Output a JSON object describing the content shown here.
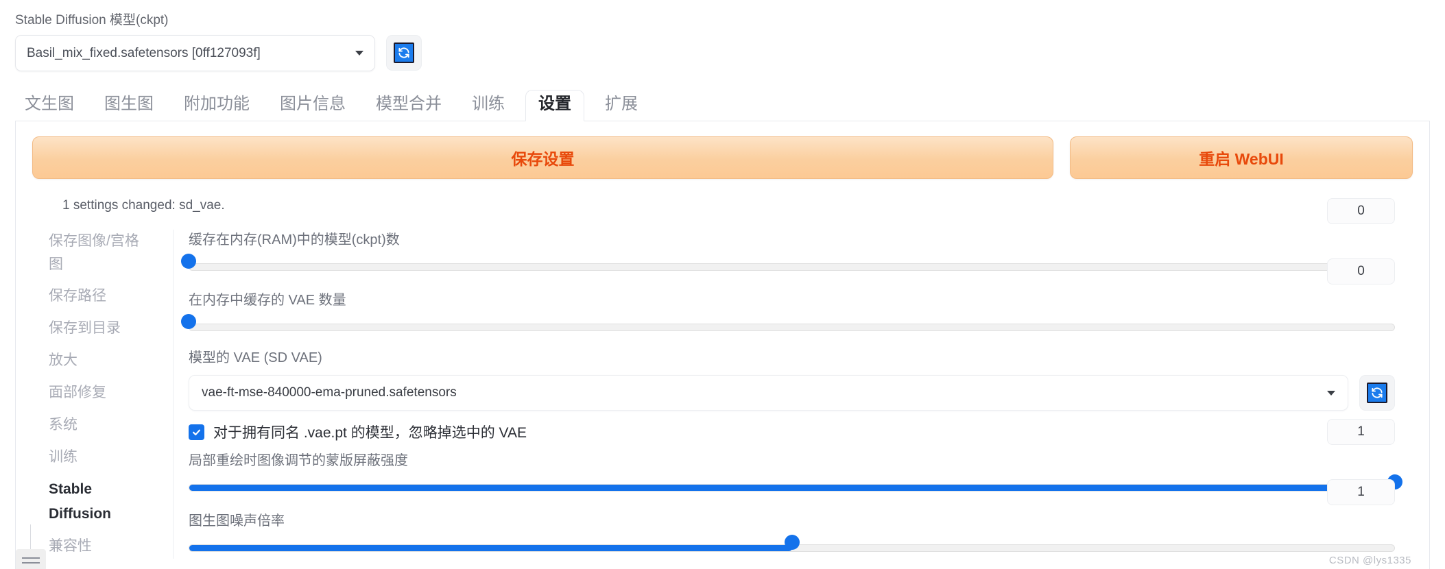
{
  "model_selector": {
    "label": "Stable Diffusion 模型(ckpt)",
    "value": "Basil_mix_fixed.safetensors [0ff127093f]",
    "refresh_icon": "refresh-icon"
  },
  "tabs": [
    {
      "label": "文生图",
      "active": false
    },
    {
      "label": "图生图",
      "active": false
    },
    {
      "label": "附加功能",
      "active": false
    },
    {
      "label": "图片信息",
      "active": false
    },
    {
      "label": "模型合并",
      "active": false
    },
    {
      "label": "训练",
      "active": false
    },
    {
      "label": "设置",
      "active": true
    },
    {
      "label": "扩展",
      "active": false
    }
  ],
  "actions": {
    "save_label": "保存设置",
    "restart_label": "重启 WebUI"
  },
  "status": {
    "message": "1 settings changed: sd_vae."
  },
  "sidebar": {
    "items": [
      {
        "label": "保存图像/宫格图",
        "active": false
      },
      {
        "label": "保存路径",
        "active": false
      },
      {
        "label": "保存到目录",
        "active": false
      },
      {
        "label": "放大",
        "active": false
      },
      {
        "label": "面部修复",
        "active": false
      },
      {
        "label": "系统",
        "active": false
      },
      {
        "label": "训练",
        "active": false
      },
      {
        "label": "Stable Diffusion",
        "active": true
      },
      {
        "label": "兼容性",
        "active": false
      }
    ],
    "menu_icon": "hamburger-icon"
  },
  "settings": {
    "ram_cache": {
      "label": "缓存在内存(RAM)中的模型(ckpt)数",
      "value": "0",
      "percent": 0
    },
    "vae_cache": {
      "label": "在内存中缓存的 VAE 数量",
      "value": "0",
      "percent": 0
    },
    "sd_vae": {
      "label": "模型的 VAE (SD VAE)",
      "value": "vae-ft-mse-840000-ema-pruned.safetensors",
      "refresh_icon": "refresh-icon"
    },
    "ignore_vae": {
      "label": "对于拥有同名 .vae.pt 的模型，忽略掉选中的 VAE",
      "checked": true
    },
    "inpaint_mask_weight": {
      "label": "局部重绘时图像调节的蒙版屏蔽强度",
      "value": "1",
      "percent": 100
    },
    "img2img_noise": {
      "label": "图生图噪声倍率",
      "value": "1",
      "percent": 50
    }
  },
  "watermark": {
    "text": "CSDN @lys1335"
  }
}
